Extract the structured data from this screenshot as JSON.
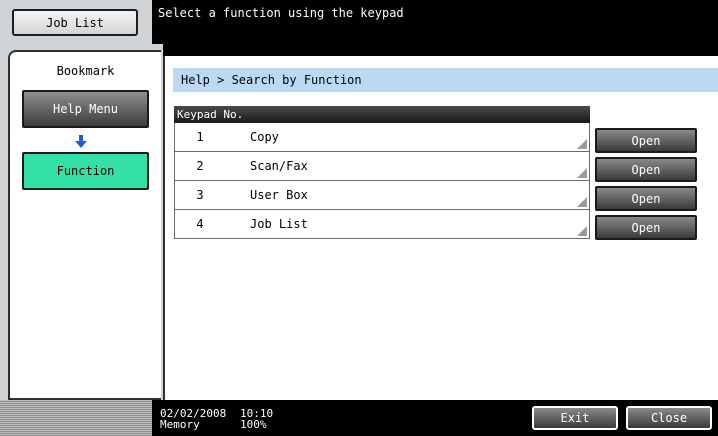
{
  "header": {
    "job_list_label": "Job List",
    "message": "Select a function using the keypad"
  },
  "bookmark": {
    "title": "Bookmark",
    "help_menu_label": "Help Menu",
    "function_label": "Function"
  },
  "main": {
    "breadcrumb": "Help > Search by Function",
    "table_header": "Keypad No.",
    "rows": [
      {
        "num": "1",
        "name": "Copy",
        "action": "Open"
      },
      {
        "num": "2",
        "name": "Scan/Fax",
        "action": "Open"
      },
      {
        "num": "3",
        "name": "User Box",
        "action": "Open"
      },
      {
        "num": "4",
        "name": "Job List",
        "action": "Open"
      }
    ]
  },
  "footer": {
    "date": "02/02/2008",
    "time": "10:10",
    "memory_label": "Memory",
    "memory_value": "100%",
    "exit_label": "Exit",
    "close_label": "Close"
  },
  "colors": {
    "accent_function": "#33e0a8",
    "breadcrumb_bg": "#bcd9f4",
    "arrow": "#1f5fd6"
  }
}
